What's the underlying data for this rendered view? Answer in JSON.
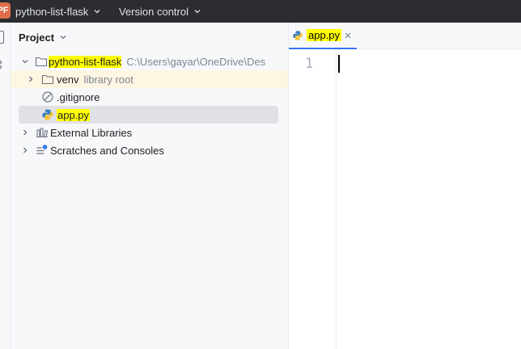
{
  "titlebar": {
    "project_badge": "PF",
    "project_name": "python-list-flask",
    "vcs_label": "Version control"
  },
  "project_panel": {
    "title": "Project",
    "tree": [
      {
        "label": "python-list-flask",
        "hint": "C:\\Users\\gayar\\OneDrive\\Des",
        "icon": "folder-icon",
        "expanded": true
      },
      {
        "label": "venv",
        "hint": "library root",
        "icon": "folder-icon",
        "expanded": false
      },
      {
        "label": ".gitignore",
        "icon": "ignored-file-icon"
      },
      {
        "label": "app.py",
        "icon": "python-file-icon",
        "selected": true
      },
      {
        "label": "External Libraries",
        "icon": "libraries-icon",
        "expanded": false
      },
      {
        "label": "Scratches and Consoles",
        "icon": "scratches-icon",
        "expanded": false
      }
    ]
  },
  "editor": {
    "tab_label": "app.py",
    "line_numbers": [
      "1"
    ]
  },
  "colors": {
    "titlebar_bg": "#2b2d30",
    "highlight": "#ffff00",
    "accent": "#3574f0"
  }
}
